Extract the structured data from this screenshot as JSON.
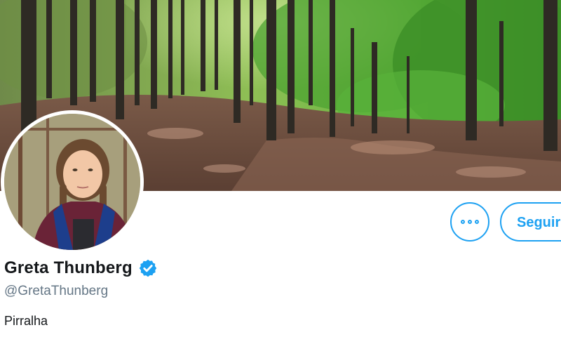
{
  "profile": {
    "display_name": "Greta Thunberg",
    "verified": true,
    "handle": "@GretaThunberg",
    "bio": "Pirralha"
  },
  "actions": {
    "more_icon": "more-dots-icon",
    "follow_label": "Seguir"
  },
  "images": {
    "banner": "forest-path-banner",
    "avatar": "profile-photo"
  },
  "colors": {
    "accent": "#1da1f2",
    "name_text": "#14171a",
    "secondary_text": "#657786"
  }
}
